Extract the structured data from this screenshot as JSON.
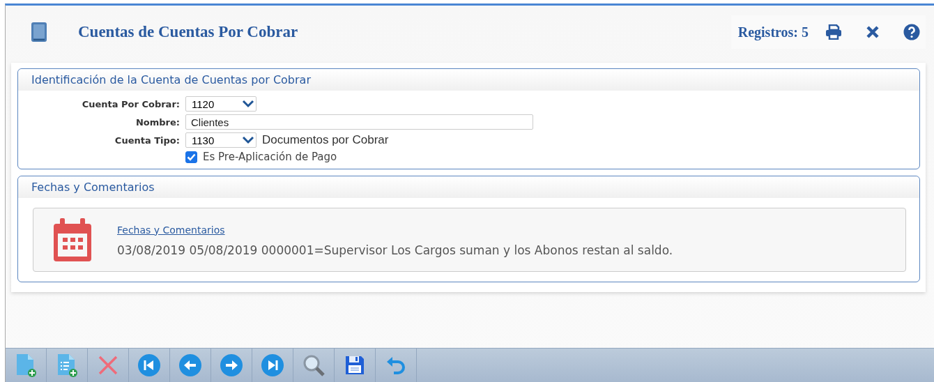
{
  "header": {
    "title": "Cuentas de Cuentas Por Cobrar",
    "records": "Registros: 5"
  },
  "identification": {
    "title": "Identificación de la Cuenta de Cuentas por Cobrar",
    "fields": [
      {
        "kind": "select",
        "label": "Cuenta Por Cobrar:",
        "value": "1120"
      },
      {
        "kind": "text",
        "label": "Nombre:",
        "value": "Clientes"
      },
      {
        "kind": "select",
        "label": "Cuenta Tipo:",
        "value": "1130",
        "description": "Documentos por Cobrar"
      }
    ],
    "checkbox": {
      "label": "Es Pre-Aplicación de Pago",
      "checked": true
    }
  },
  "dates": {
    "title": "Fechas y Comentarios",
    "link": "Fechas y Comentarios",
    "text": "03/08/2019 05/08/2019 0000001=Supervisor Los Cargos suman y los Abonos restan al saldo."
  },
  "toolbar": [
    {
      "kind": "new"
    },
    {
      "kind": "new-list"
    },
    {
      "kind": "delete"
    },
    {
      "kind": "first"
    },
    {
      "kind": "prev"
    },
    {
      "kind": "next"
    },
    {
      "kind": "last"
    },
    {
      "kind": "search"
    },
    {
      "kind": "save"
    },
    {
      "kind": "undo"
    }
  ]
}
